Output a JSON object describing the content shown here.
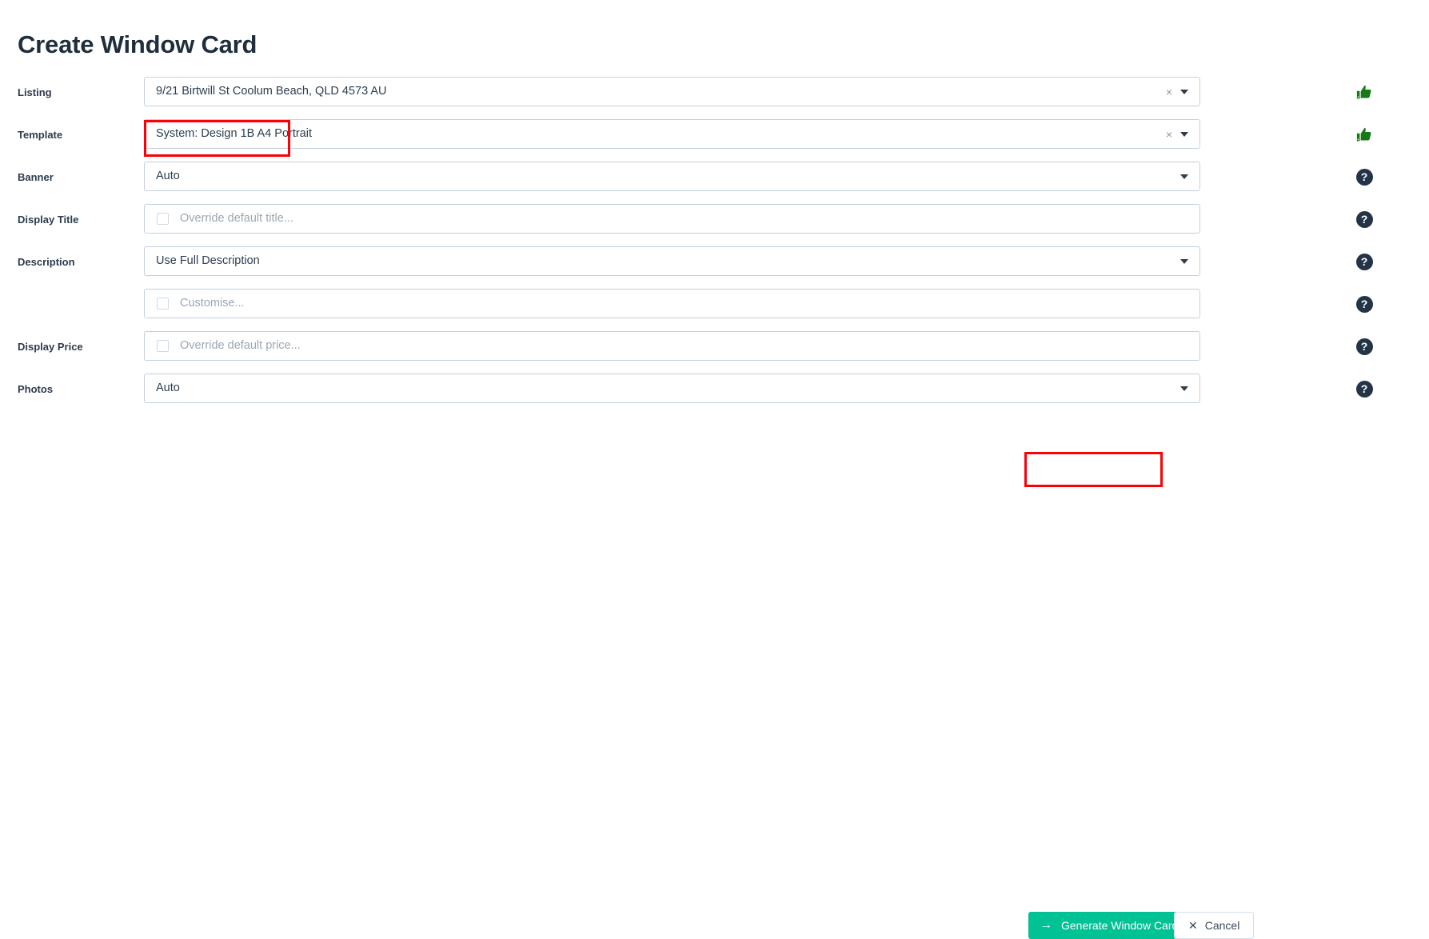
{
  "page": {
    "title": "Create Window Card"
  },
  "colors": {
    "accent_green": "#00c295",
    "thumb_green": "#157a15",
    "help_navy": "#243447",
    "annotation_red": "#fb0007",
    "field_border": "#c3d0de",
    "label_text": "#2d3b4e",
    "placeholder_text": "#9aa7b4"
  },
  "form": {
    "rows": [
      {
        "label": "Listing",
        "value": "9/21 Birtwill St Coolum Beach, QLD 4573 AU",
        "placeholder": "",
        "is_placeholder": false,
        "has_checkbox": false,
        "has_clear": true,
        "has_caret": true,
        "status_icon": "thumbs-up-icon",
        "highlighted": false
      },
      {
        "label": "Template",
        "value": "System: Design 1B A4 Portrait",
        "placeholder": "",
        "is_placeholder": false,
        "has_checkbox": false,
        "has_clear": true,
        "has_caret": true,
        "status_icon": "thumbs-up-icon",
        "highlighted": true
      },
      {
        "label": "Banner",
        "value": "Auto",
        "placeholder": "",
        "is_placeholder": false,
        "has_checkbox": false,
        "has_clear": false,
        "has_caret": true,
        "status_icon": "help-icon",
        "highlighted": false
      },
      {
        "label": "Display Title",
        "value": "Override default title...",
        "placeholder": "Override default title...",
        "is_placeholder": true,
        "has_checkbox": true,
        "has_clear": false,
        "has_caret": false,
        "status_icon": "help-icon",
        "highlighted": false
      },
      {
        "label": "Description",
        "value": "Use Full Description",
        "placeholder": "",
        "is_placeholder": false,
        "has_checkbox": false,
        "has_clear": false,
        "has_caret": true,
        "status_icon": "help-icon",
        "highlighted": false
      },
      {
        "label": "",
        "value": "Customise...",
        "placeholder": "Customise...",
        "is_placeholder": true,
        "has_checkbox": true,
        "has_clear": false,
        "has_caret": false,
        "status_icon": "help-icon",
        "highlighted": false
      },
      {
        "label": "Display Price",
        "value": "Override default price...",
        "placeholder": "Override default price...",
        "is_placeholder": true,
        "has_checkbox": true,
        "has_clear": false,
        "has_caret": false,
        "status_icon": "help-icon",
        "highlighted": false
      },
      {
        "label": "Photos",
        "value": "Auto",
        "placeholder": "",
        "is_placeholder": false,
        "has_checkbox": false,
        "has_clear": false,
        "has_caret": true,
        "status_icon": "help-icon",
        "highlighted": false
      }
    ]
  },
  "footer": {
    "generate_label": "Generate Window Card",
    "generate_icon": "arrow-right-icon",
    "cancel_label": "Cancel",
    "cancel_icon": "x-icon"
  },
  "icons": {
    "clear_glyph": "×",
    "help_glyph": "?",
    "arrow_glyph": "→",
    "x_glyph": "✕"
  }
}
